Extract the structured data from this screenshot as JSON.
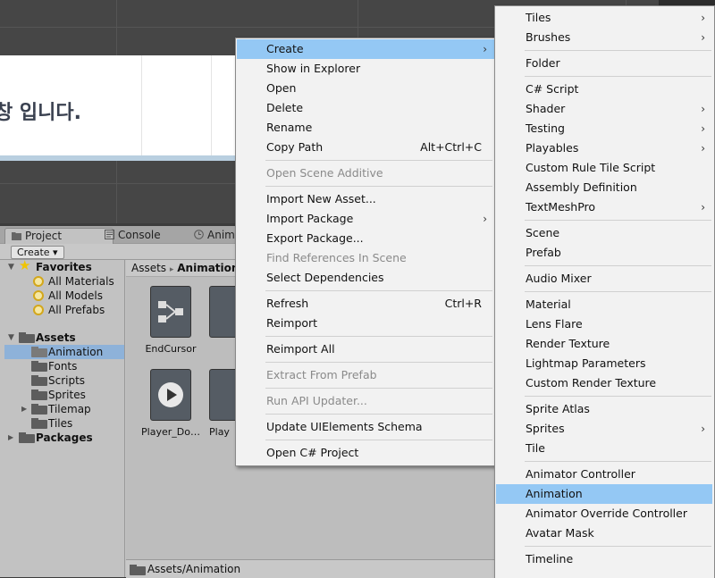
{
  "scene": {
    "canvas_text": "창 입니다."
  },
  "project_panel": {
    "tabs": [
      {
        "label": "Project",
        "icon": "folder-icon"
      },
      {
        "label": "Console",
        "icon": "console-icon"
      },
      {
        "label": "Anima",
        "icon": "clock-icon"
      }
    ],
    "create_button": "Create ▾",
    "tree": {
      "favorites_label": "Favorites",
      "favorites": [
        "All Materials",
        "All Models",
        "All Prefabs"
      ],
      "assets_label": "Assets",
      "assets_children": [
        "Animation",
        "Fonts",
        "Scripts",
        "Sprites",
        "Tilemap",
        "Tiles"
      ],
      "packages_label": "Packages"
    },
    "breadcrumb": {
      "root": "Assets",
      "sep": "▸",
      "current": "Animation"
    },
    "assets": [
      {
        "name": "EndCursor",
        "icon": "animator-controller-icon"
      },
      {
        "name": "Player_Do…",
        "icon": "animation-clip-icon"
      },
      {
        "name": "Play",
        "icon": "animation-clip-icon"
      }
    ],
    "status_path": "Assets/Animation"
  },
  "context_menu": {
    "items": [
      {
        "label": "Create",
        "arrow": true,
        "highlighted": true
      },
      {
        "label": "Show in Explorer"
      },
      {
        "label": "Open"
      },
      {
        "label": "Delete"
      },
      {
        "label": "Rename"
      },
      {
        "label": "Copy Path",
        "shortcut": "Alt+Ctrl+C"
      },
      {
        "label": "Open Scene Additive",
        "disabled": true
      },
      {
        "label": "Import New Asset..."
      },
      {
        "label": "Import Package",
        "arrow": true
      },
      {
        "label": "Export Package..."
      },
      {
        "label": "Find References In Scene",
        "disabled": true
      },
      {
        "label": "Select Dependencies"
      },
      {
        "label": "Refresh",
        "shortcut": "Ctrl+R"
      },
      {
        "label": "Reimport"
      },
      {
        "label": "Reimport All"
      },
      {
        "label": "Extract From Prefab",
        "disabled": true
      },
      {
        "label": "Run API Updater...",
        "disabled": true
      },
      {
        "label": "Update UIElements Schema"
      },
      {
        "label": "Open C# Project"
      }
    ]
  },
  "create_submenu": {
    "items": [
      {
        "label": "Tiles",
        "arrow": true
      },
      {
        "label": "Brushes",
        "arrow": true
      },
      {
        "label": "Folder"
      },
      {
        "label": "C# Script"
      },
      {
        "label": "Shader",
        "arrow": true
      },
      {
        "label": "Testing",
        "arrow": true
      },
      {
        "label": "Playables",
        "arrow": true
      },
      {
        "label": "Custom Rule Tile Script"
      },
      {
        "label": "Assembly Definition"
      },
      {
        "label": "TextMeshPro",
        "arrow": true
      },
      {
        "label": "Scene"
      },
      {
        "label": "Prefab"
      },
      {
        "label": "Audio Mixer"
      },
      {
        "label": "Material"
      },
      {
        "label": "Lens Flare"
      },
      {
        "label": "Render Texture"
      },
      {
        "label": "Lightmap Parameters"
      },
      {
        "label": "Custom Render Texture"
      },
      {
        "label": "Sprite Atlas"
      },
      {
        "label": "Sprites",
        "arrow": true
      },
      {
        "label": "Tile"
      },
      {
        "label": "Animator Controller"
      },
      {
        "label": "Animation",
        "highlighted": true
      },
      {
        "label": "Animator Override Controller"
      },
      {
        "label": "Avatar Mask"
      },
      {
        "label": "Timeline"
      }
    ]
  },
  "colors": {
    "highlight": "#94c8f4",
    "selection": "#8eb2d9",
    "menu_bg": "#f2f2f2"
  }
}
